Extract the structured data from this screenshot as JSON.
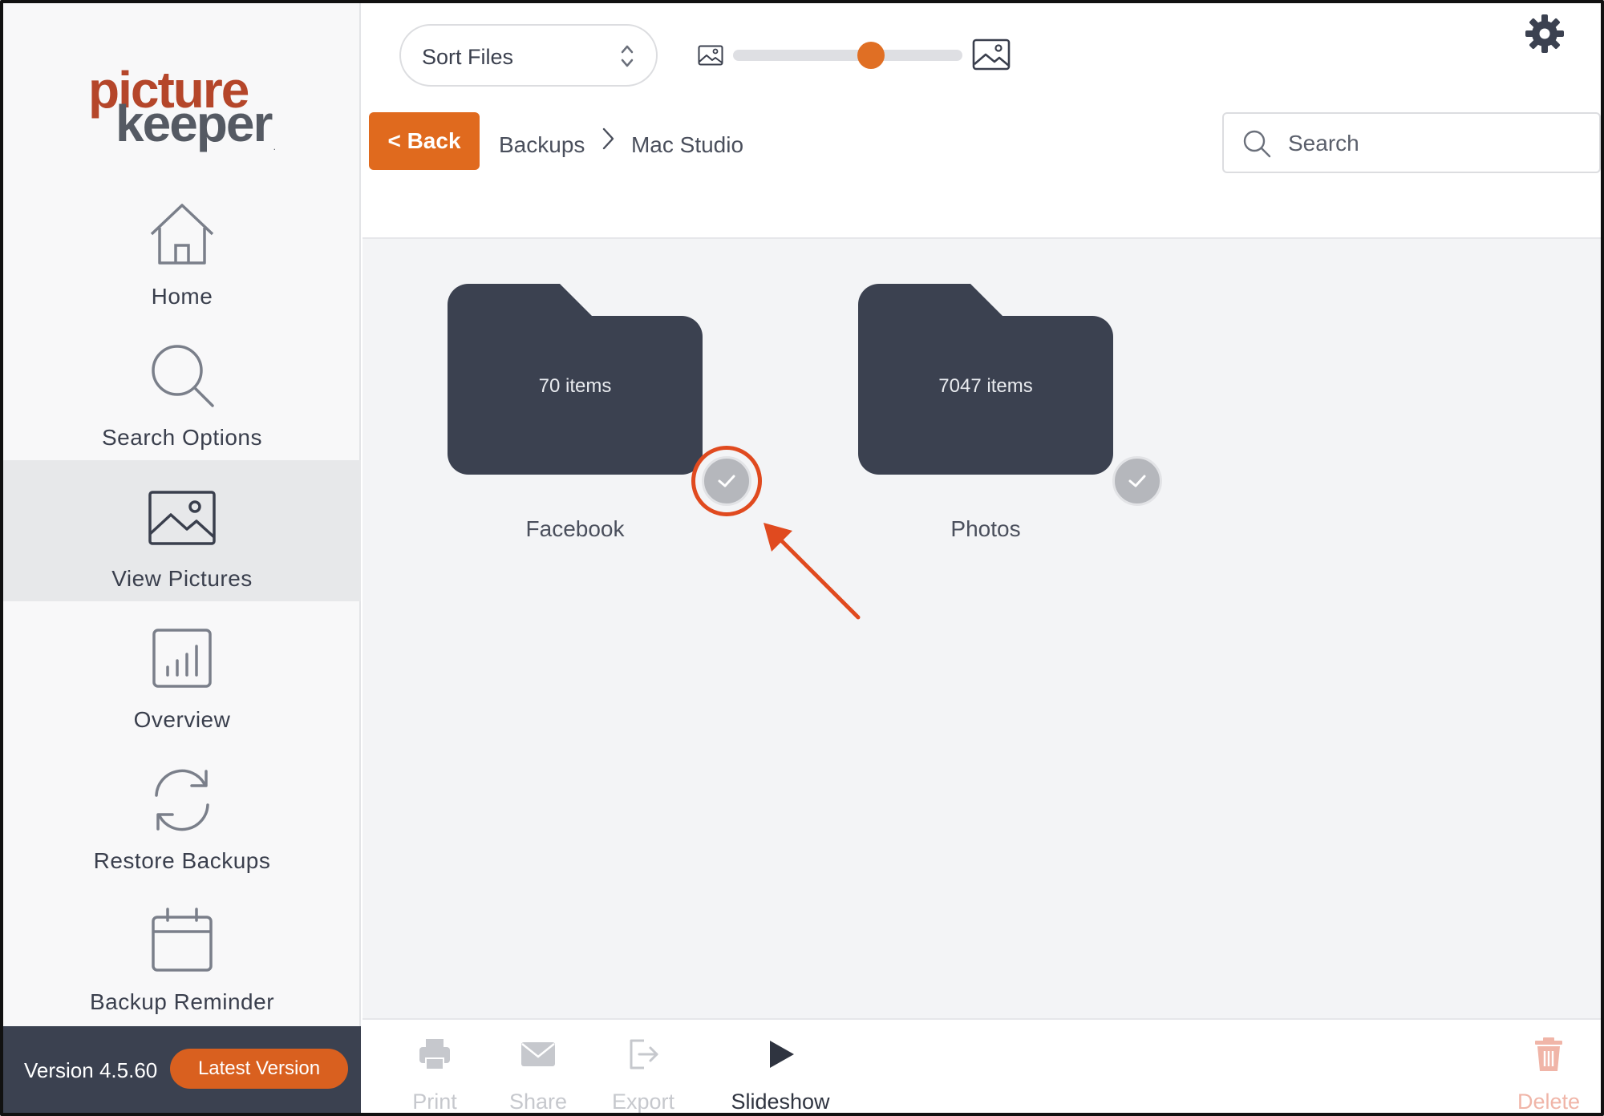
{
  "app": {
    "name": "PictureKeeper"
  },
  "logo": {
    "line1": "picture",
    "line2": "keeper",
    "mark": "."
  },
  "sidebar": {
    "items": [
      {
        "label": "Home",
        "icon": "home-icon",
        "active": false
      },
      {
        "label": "Search Options",
        "icon": "search-icon",
        "active": false
      },
      {
        "label": "View Pictures",
        "icon": "picture-icon",
        "active": true
      },
      {
        "label": "Overview",
        "icon": "bar-chart-icon",
        "active": false
      },
      {
        "label": "Restore Backups",
        "icon": "refresh-icon",
        "active": false
      },
      {
        "label": "Backup Reminder",
        "icon": "calendar-icon",
        "active": false
      }
    ],
    "version_text": "Version 4.5.60",
    "version_badge": "Latest Version"
  },
  "toolbar": {
    "sort_label": "Sort Files",
    "zoom_level": 0.6,
    "back_label": "< Back",
    "breadcrumb": [
      "Backups",
      "Mac Studio"
    ],
    "search_placeholder": "Search"
  },
  "folders": [
    {
      "name": "Facebook",
      "count": "70 items",
      "highlighted": true
    },
    {
      "name": "Photos",
      "count": "7047 items",
      "highlighted": false
    }
  ],
  "bottom_bar": {
    "print": "Print",
    "share": "Share",
    "export": "Export",
    "slideshow": "Slideshow",
    "delete": "Delete"
  },
  "colors": {
    "accent": "#e06a1e",
    "folder": "#3b4150",
    "sidebar_bg": "#f8f8f9",
    "content_bg": "#f3f4f6",
    "annotation": "#e04a1f"
  }
}
